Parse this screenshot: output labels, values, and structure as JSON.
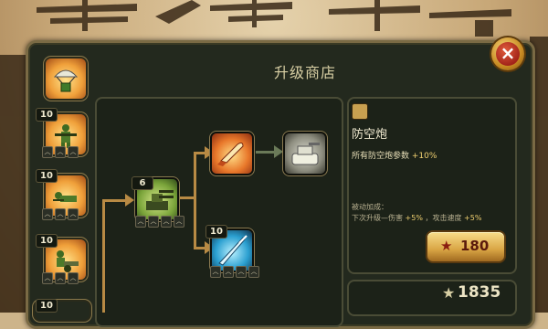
{
  "shop": {
    "title": "升级商店",
    "close_label": "×"
  },
  "units": [
    {
      "name": "paratrooper-drop",
      "level": ""
    },
    {
      "name": "rifleman",
      "level": "10"
    },
    {
      "name": "prone-soldier",
      "level": "10"
    },
    {
      "name": "field-gunner",
      "level": "10"
    },
    {
      "name": "partial-unit",
      "level": "10"
    }
  ],
  "tree": {
    "root": {
      "icon": "anti-air-gun-icon",
      "level": "6"
    },
    "upper": {
      "icon": "shell-icon",
      "level": ""
    },
    "lower": {
      "icon": "blade-icon",
      "level": "10"
    },
    "locked": {
      "icon": "turret-locked-icon"
    }
  },
  "info": {
    "name": "防空炮",
    "desc_text": "所有防空炮参数",
    "desc_bonus": "+10%",
    "passive_label": "被动加成：",
    "passive_text_a": "下次升级—伤害",
    "passive_bonus_a": "+5%",
    "passive_text_b": "，攻击速度",
    "passive_bonus_b": "+5%"
  },
  "price": {
    "star": "★",
    "value": "180"
  },
  "balance": {
    "star": "★",
    "value": "1835"
  },
  "colors": {
    "panel": "#23291e",
    "accent_gold": "#d9a544",
    "text_light": "#f0ead0",
    "highlight": "#f0d070"
  }
}
